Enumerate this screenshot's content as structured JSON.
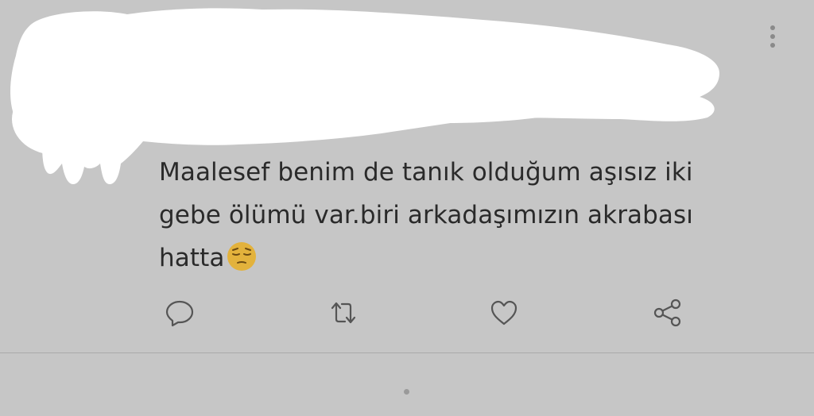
{
  "tweet": {
    "text_lines": [
      "Maalesef benim de tanık olduğum aşısız iki",
      "gebe ölümü var.biri arkadaşımızın akrabası",
      "hatta"
    ],
    "emoji": "pensive-face-emoji"
  },
  "actions": {
    "reply_icon": "reply-icon",
    "retweet_icon": "retweet-icon",
    "like_icon": "heart-icon",
    "share_icon": "share-icon"
  },
  "menu": {
    "more_icon": "more-vertical-icon"
  },
  "colors": {
    "background": "#c6c6c6",
    "text": "#2a2a2a",
    "icon": "#555555",
    "redaction": "#ffffff",
    "emoji": "#e3b23c"
  }
}
